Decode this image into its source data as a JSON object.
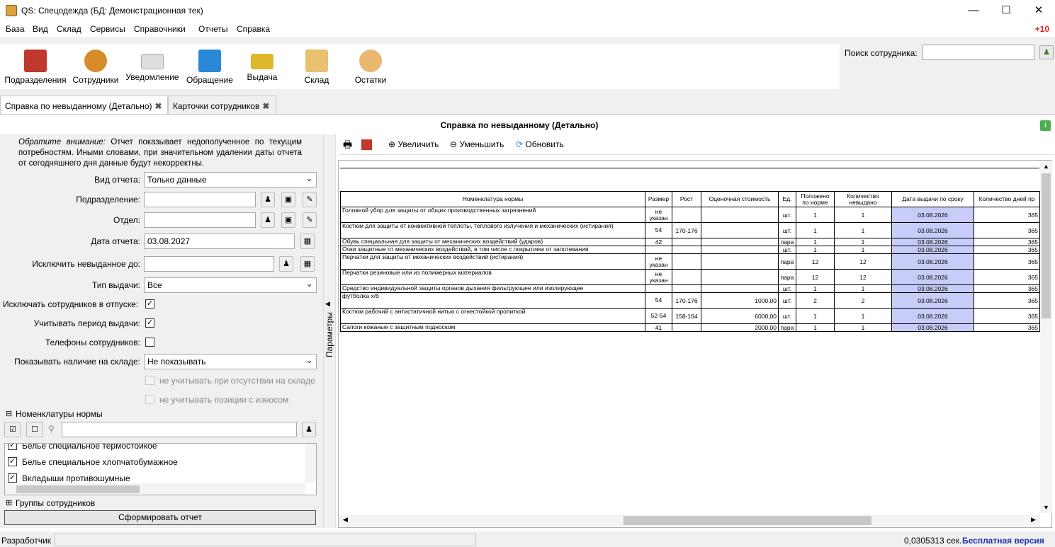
{
  "window": {
    "title": "QS: Спецодежда (БД: Демонстрационная тек)",
    "minimize": "—",
    "maximize": "☐",
    "close": "✕"
  },
  "menu": [
    "База",
    "Вид",
    "Склад",
    "Сервисы",
    "Справочники",
    "Отчеты",
    "Справка"
  ],
  "menu_badge": "+10",
  "toolbar": [
    {
      "label": "Подразделения",
      "icon": "house-icon",
      "color": "#c0392b"
    },
    {
      "label": "Сотрудники",
      "icon": "people-icon",
      "color": "#d98b2b"
    },
    {
      "label": "Уведомление",
      "icon": "envelope-icon",
      "color": "#d8d8d8"
    },
    {
      "label": "Обращение",
      "icon": "mailbox-icon",
      "color": "#2b88d8"
    },
    {
      "label": "Выдача",
      "icon": "card-icon",
      "color": "#e0b82b"
    },
    {
      "label": "Склад",
      "icon": "box-icon",
      "color": "#e8c070"
    },
    {
      "label": "Остатки",
      "icon": "magnifier-box-icon",
      "color": "#e8b870"
    }
  ],
  "search": {
    "label": "Поиск сотрудника:",
    "value": ""
  },
  "tabs": [
    {
      "label": "Справка по невыданному (Детально)"
    },
    {
      "label": "Карточки сотрудников"
    }
  ],
  "report_title": "Справка по невыданному (Детально)",
  "note_prefix": "Обратите внимание:",
  "note_text": " Отчет показывает недополученное по текущим потребностям. Иными словами, при значительном удалении даты отчета от сегодняшнего дня данные будут некорректны.",
  "params": {
    "report_type_label": "Вид отчета:",
    "report_type": "Только данные",
    "division_label": "Подразделение:",
    "department_label": "Отдел:",
    "date_label": "Дата отчета:",
    "date": "03.08.2027",
    "exclude_label": "Исключить невыданное до:",
    "issue_type_label": "Тип выдачи:",
    "issue_type": "Все",
    "vacation_label": "Исключать сотрудников в отпуске:",
    "period_label": "Учитывать период выдачи:",
    "phones_label": "Телефоны сотрудников:",
    "stock_label": "Показывать наличие на складе:",
    "stock": "Не показывать",
    "absent_label": "не учитывать при отсутствии на складе",
    "wear_label": "не учитывать позиции с износом",
    "nomenclature_group": "Номенклатуры нормы",
    "employee_groups": "Группы сотрудников",
    "submit": "Сформировать отчет",
    "side_tab": "Параметры"
  },
  "nomenclature_items": [
    "Белье специальное термостойкое",
    "Белье специальное хлопчатобумажное",
    "Вкладыши противошумные"
  ],
  "report_toolbar": {
    "zoom_in": "Увеличить",
    "zoom_out": "Уменьшить",
    "refresh": "Обновить"
  },
  "table": {
    "columns": [
      "Номенклатура нормы",
      "Размер",
      "Рост",
      "Оценочная стоимость",
      "Ед.",
      "Положено по норме",
      "Количество невыдано",
      "Дата выдачи по сроку",
      "Количество дней пр"
    ],
    "rows": [
      [
        "Головной убор для защиты от общих производственных загрязнений",
        "не указан",
        "",
        "",
        "шт.",
        "1",
        "1",
        "03.08.2026",
        "365"
      ],
      [
        "Костюм для защиты от конвективной теплоты, теплового излучения и механических (истирания)",
        "54",
        "170-176",
        "",
        "шт.",
        "1",
        "1",
        "03.08.2026",
        "365"
      ],
      [
        "Обувь специальная для защиты от механических воздействий (ударов)",
        "42",
        "",
        "",
        "пара",
        "1",
        "1",
        "03.08.2026",
        "365"
      ],
      [
        "Очки защитные от механических воздействий, в том числе с покрытием от запотевания",
        "",
        "",
        "",
        "шт.",
        "1",
        "1",
        "03.08.2026",
        "365"
      ],
      [
        "Перчатки для защиты от механических воздействий (истирания)",
        "не указан",
        "",
        "",
        "пара",
        "12",
        "12",
        "03.08.2026",
        "365"
      ],
      [
        "Перчатки резиновые или из полимерных материалов",
        "не указан",
        "",
        "",
        "пара",
        "12",
        "12",
        "03.08.2026",
        "365"
      ],
      [
        "Средство индивидуальной защиты органов дыхания фильтрующее или изолирующее",
        "",
        "",
        "",
        "шт.",
        "1",
        "1",
        "03.08.2026",
        "365"
      ],
      [
        "футболка х/б",
        "54",
        "170-176",
        "1000,00",
        "шт.",
        "2",
        "2",
        "03.08.2026",
        "365"
      ],
      [
        "Костюм рабочий с антистатичной нитью с огнестойкой пропиткой",
        "52-54",
        "158-164",
        "6000,00",
        "шт.",
        "1",
        "1",
        "03.08.2026",
        "365"
      ],
      [
        "Сапоги кожаные с защитным подноском",
        "41",
        "",
        "2000,00",
        "пара",
        "1",
        "1",
        "03.08.2026",
        "365"
      ]
    ]
  },
  "status": {
    "user": "Разработчик",
    "time": "0,0305313 сек.",
    "edition": "Бесплатная версия"
  }
}
